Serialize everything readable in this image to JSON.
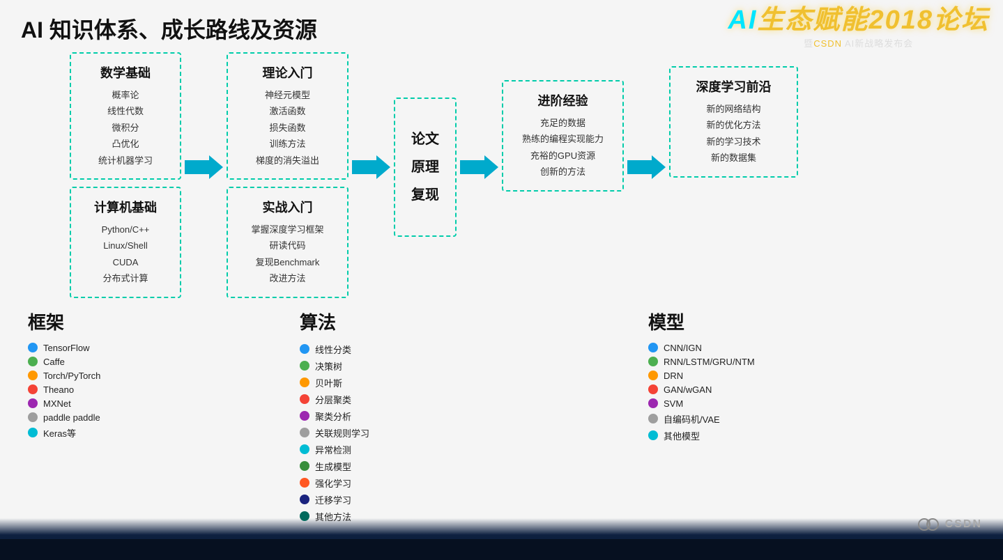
{
  "header": {
    "title": "AI 知识体系、成长路线及资源"
  },
  "logo": {
    "ai_prefix": "AI",
    "title": "生态赋能2018论坛",
    "subtitle": "暨CSDN AI新战略发布会"
  },
  "flow": {
    "box1": {
      "title": "数学基础",
      "items": [
        "概率论",
        "线性代数",
        "微积分",
        "凸优化",
        "统计机器学习"
      ]
    },
    "box2": {
      "title": "计算机基础",
      "items": [
        "Python/C++",
        "Linux/Shell",
        "CUDA",
        "分布式计算"
      ]
    },
    "box3": {
      "title": "理论入门",
      "items": [
        "神经元模型",
        "激活函数",
        "损失函数",
        "训练方法",
        "梯度的消失溢出"
      ]
    },
    "box4": {
      "title": "实战入门",
      "items": [
        "掌握深度学习框架",
        "研读代码",
        "复现Benchmark",
        "改进方法"
      ]
    },
    "box5": {
      "title": "论文\n原理\n复现",
      "chars": [
        "论文",
        "原理",
        "复现"
      ]
    },
    "box6": {
      "title": "进阶经验",
      "items": [
        "充足的数据",
        "熟练的编程实现能力",
        "充裕的GPU资源",
        "创新的方法"
      ]
    },
    "box7": {
      "title": "深度学习前沿",
      "items": [
        "新的网络结构",
        "新的优化方法",
        "新的学习技术",
        "新的数据集"
      ]
    },
    "arrows": [
      "→",
      "→",
      "→",
      "→"
    ]
  },
  "framework": {
    "label": "框架",
    "items": [
      {
        "color": "#2196F3",
        "name": "TensorFlow"
      },
      {
        "color": "#4CAF50",
        "name": "Caffe"
      },
      {
        "color": "#FF9800",
        "name": "Torch/PyTorch"
      },
      {
        "color": "#F44336",
        "name": "Theano"
      },
      {
        "color": "#9C27B0",
        "name": "MXNet"
      },
      {
        "color": "#9E9E9E",
        "name": "paddle paddle"
      },
      {
        "color": "#00BCD4",
        "name": "Keras等"
      }
    ]
  },
  "algorithm": {
    "label": "算法",
    "items": [
      {
        "color": "#2196F3",
        "name": "线性分类"
      },
      {
        "color": "#4CAF50",
        "name": "决策树"
      },
      {
        "color": "#FF9800",
        "name": "贝叶斯"
      },
      {
        "color": "#F44336",
        "name": "分层聚类"
      },
      {
        "color": "#9C27B0",
        "name": "聚类分析"
      },
      {
        "color": "#9E9E9E",
        "name": "关联规则学习"
      },
      {
        "color": "#00BCD4",
        "name": "异常检测"
      },
      {
        "color": "#388E3C",
        "name": "生成模型"
      },
      {
        "color": "#FF5722",
        "name": "强化学习"
      },
      {
        "color": "#1A237E",
        "name": "迁移学习"
      },
      {
        "color": "#00695C",
        "name": "其他方法"
      }
    ]
  },
  "model": {
    "label": "模型",
    "items": [
      {
        "color": "#2196F3",
        "name": "CNN/IGN"
      },
      {
        "color": "#4CAF50",
        "name": "RNN/LSTM/GRU/NTM"
      },
      {
        "color": "#FF9800",
        "name": "DRN"
      },
      {
        "color": "#F44336",
        "name": "GAN/wGAN"
      },
      {
        "color": "#9C27B0",
        "name": "SVM"
      },
      {
        "color": "#9E9E9E",
        "name": "自编码机/VAE"
      },
      {
        "color": "#00BCD4",
        "name": "其他模型"
      }
    ]
  }
}
